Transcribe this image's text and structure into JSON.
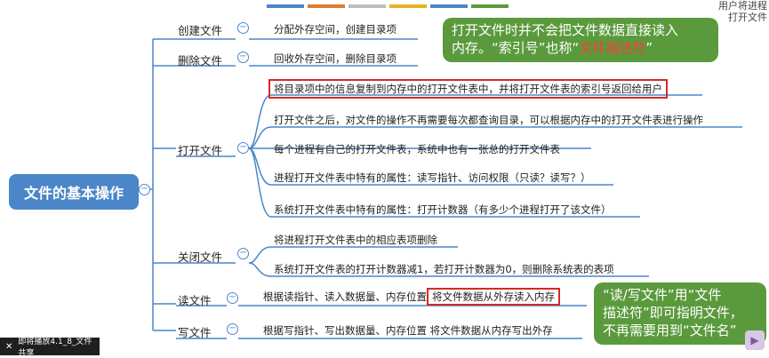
{
  "top_bars": [
    "#4a86c8",
    "#e07b2b",
    "#bdbdbd",
    "#e6b422",
    "#4a86c8",
    "#5a9a3c"
  ],
  "corner_note": [
    "用户将进程",
    "打开文件"
  ],
  "root": {
    "label": "文件的基本操作"
  },
  "branches": {
    "create": {
      "label": "创建文件",
      "leaf": "分配外存空间，创建目录项"
    },
    "delete": {
      "label": "删除文件",
      "leaf": "回收外存空间，删除目录项"
    },
    "open": {
      "label": "打开文件",
      "leaves": [
        "将目录项中的信息复制到内存中的打开文件表中，并将打开文件表的索引号返回给用户",
        "打开文件之后，对文件的操作不再需要每次都查询目录，可以根据内存中的打开文件表进行操作",
        "每个进程有自己的打开文件表，系统中也有一张总的打开文件表",
        "进程打开文件表中特有的属性：读写指针、访问权限（只读？读写？）",
        "系统打开文件表中特有的属性：打开计数器（有多少个进程打开了该文件）"
      ]
    },
    "close": {
      "label": "关闭文件",
      "leaves": [
        "将进程打开文件表中的相应表项删除",
        "系统打开文件表的打开计数器减1，若打开计数器为0，则删除系统表的表项"
      ]
    },
    "read": {
      "label": "读文件",
      "leaf_prefix": "根据读指针、读入数据量、内存位置",
      "leaf_highlight": "将文件数据从外存读入内存"
    },
    "write": {
      "label": "写文件",
      "leaf": "根据写指针、写出数据量、内存位置 将文件数据从内存写出外存"
    }
  },
  "bubble_top": {
    "line1": "打开文件时并不会把文件数据直接读入",
    "line2_a": "内存。“索引号”也称“",
    "line2_red": "文件描述符",
    "line2_b": "”"
  },
  "bubble_bottom": {
    "line1": "“读/写文件”用“文件",
    "line2": "描述符”即可指明文件，",
    "line3": "不再需要用到“文件名”"
  },
  "player": {
    "label": "即将播放4.1_8_文件共享"
  }
}
